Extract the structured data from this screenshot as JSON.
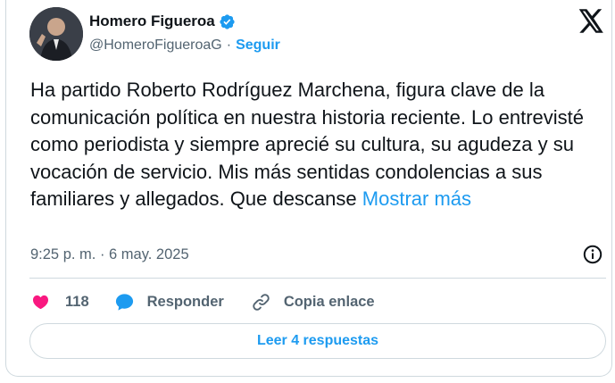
{
  "author": {
    "name": "Homero Figueroa",
    "handle": "@HomeroFigueroaG",
    "separator": "·",
    "follow_label": "Seguir"
  },
  "tweet": {
    "text": "Ha partido Roberto Rodríguez Marchena, figura clave de la comunicación política en nuestra historia reciente. Lo entrevisté como periodista y siempre aprecié su cultura, su agudeza y su vocación de servicio. Mis más sentidas condolencias a sus familiares y allegados. Que descanse",
    "show_more": "Mostrar más",
    "time": "9:25 p. m.",
    "date_separator": " · ",
    "date": "6 may. 2025"
  },
  "actions": {
    "like_count": "118",
    "reply_label": "Responder",
    "copy_label": "Copia enlace"
  },
  "footer": {
    "replies_label": "Leer 4 respuestas"
  },
  "colors": {
    "accent": "#1d9bf0",
    "like": "#f91880",
    "text": "#0f1419",
    "muted": "#536471"
  },
  "icons": [
    "verified-badge-icon",
    "x-logo-icon",
    "info-icon",
    "heart-icon",
    "reply-bubble-icon",
    "link-icon"
  ]
}
